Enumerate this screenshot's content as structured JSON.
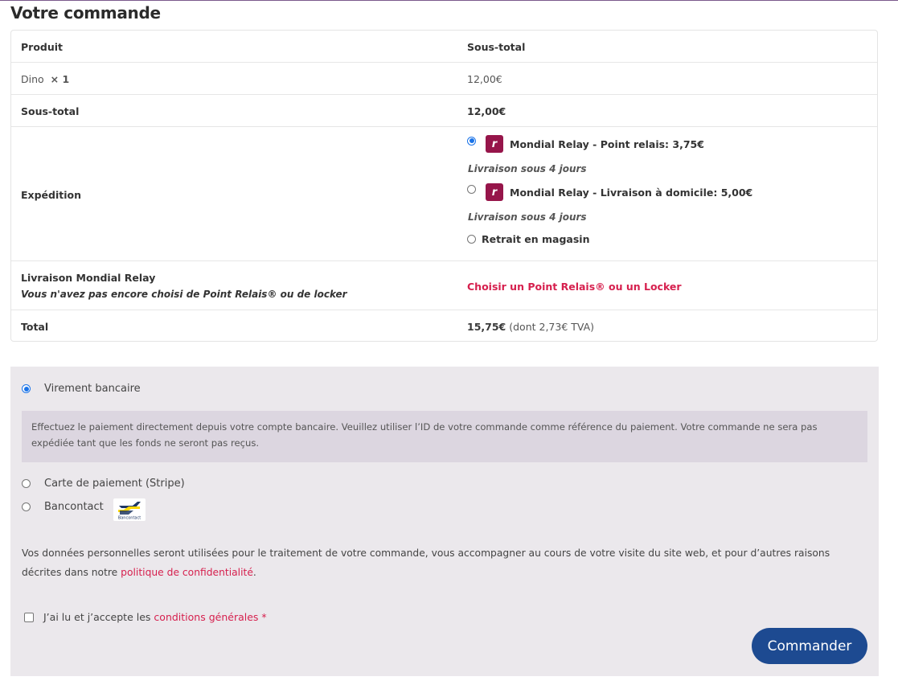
{
  "page": {
    "title": "Votre commande"
  },
  "order": {
    "headers": {
      "product": "Produit",
      "subtotal": "Sous-total"
    },
    "item": {
      "name": "Dino",
      "qty": "× 1",
      "price": "12,00€"
    },
    "subtotal": {
      "label": "Sous-total",
      "value": "12,00€"
    },
    "shipping": {
      "label": "Expédition",
      "options": [
        {
          "label": "Mondial Relay - Point relais: 3,75€",
          "note": "Livraison sous 4 jours",
          "selected": true,
          "icon": "mondial-relay-logo"
        },
        {
          "label": "Mondial Relay - Livraison à domicile: 5,00€",
          "note": "Livraison sous 4 jours",
          "selected": false,
          "icon": "mondial-relay-logo"
        },
        {
          "label": "Retrait en magasin",
          "selected": false
        }
      ]
    },
    "relay": {
      "label": "Livraison Mondial Relay",
      "note": "Vous n'avez pas encore choisi de Point Relais® ou de locker",
      "link": "Choisir un Point Relais® ou un Locker"
    },
    "total": {
      "label": "Total",
      "value": "15,75€",
      "tax": "(dont 2,73€ TVA)"
    }
  },
  "payment": {
    "methods": [
      {
        "label": "Virement bancaire",
        "selected": true
      },
      {
        "label": "Carte de paiement (Stripe)",
        "selected": false
      },
      {
        "label": "Bancontact",
        "selected": false,
        "icon": "bancontact-logo",
        "icon_text": "Bancontact"
      }
    ],
    "description": "Effectuez le paiement directement depuis votre compte bancaire. Veuillez utiliser l’ID de votre commande comme référence du paiement. Votre commande ne sera pas expédiée tant que les fonds ne seront pas reçus.",
    "privacy_text": "Vos données personnelles seront utilisées pour le traitement de votre commande, vous accompagner au cours de votre visite du site web, et pour d’autres raisons décrites dans notre",
    "privacy_link": "politique de confidentialité",
    "privacy_end": ".",
    "terms_text": "J’ai lu et j’accepte les",
    "terms_link": "conditions générales",
    "terms_required": "*",
    "submit_label": "Commander"
  },
  "colors": {
    "accent_red": "#d6204e",
    "button": "#1d4a91",
    "mondial_relay": "#96154a"
  }
}
